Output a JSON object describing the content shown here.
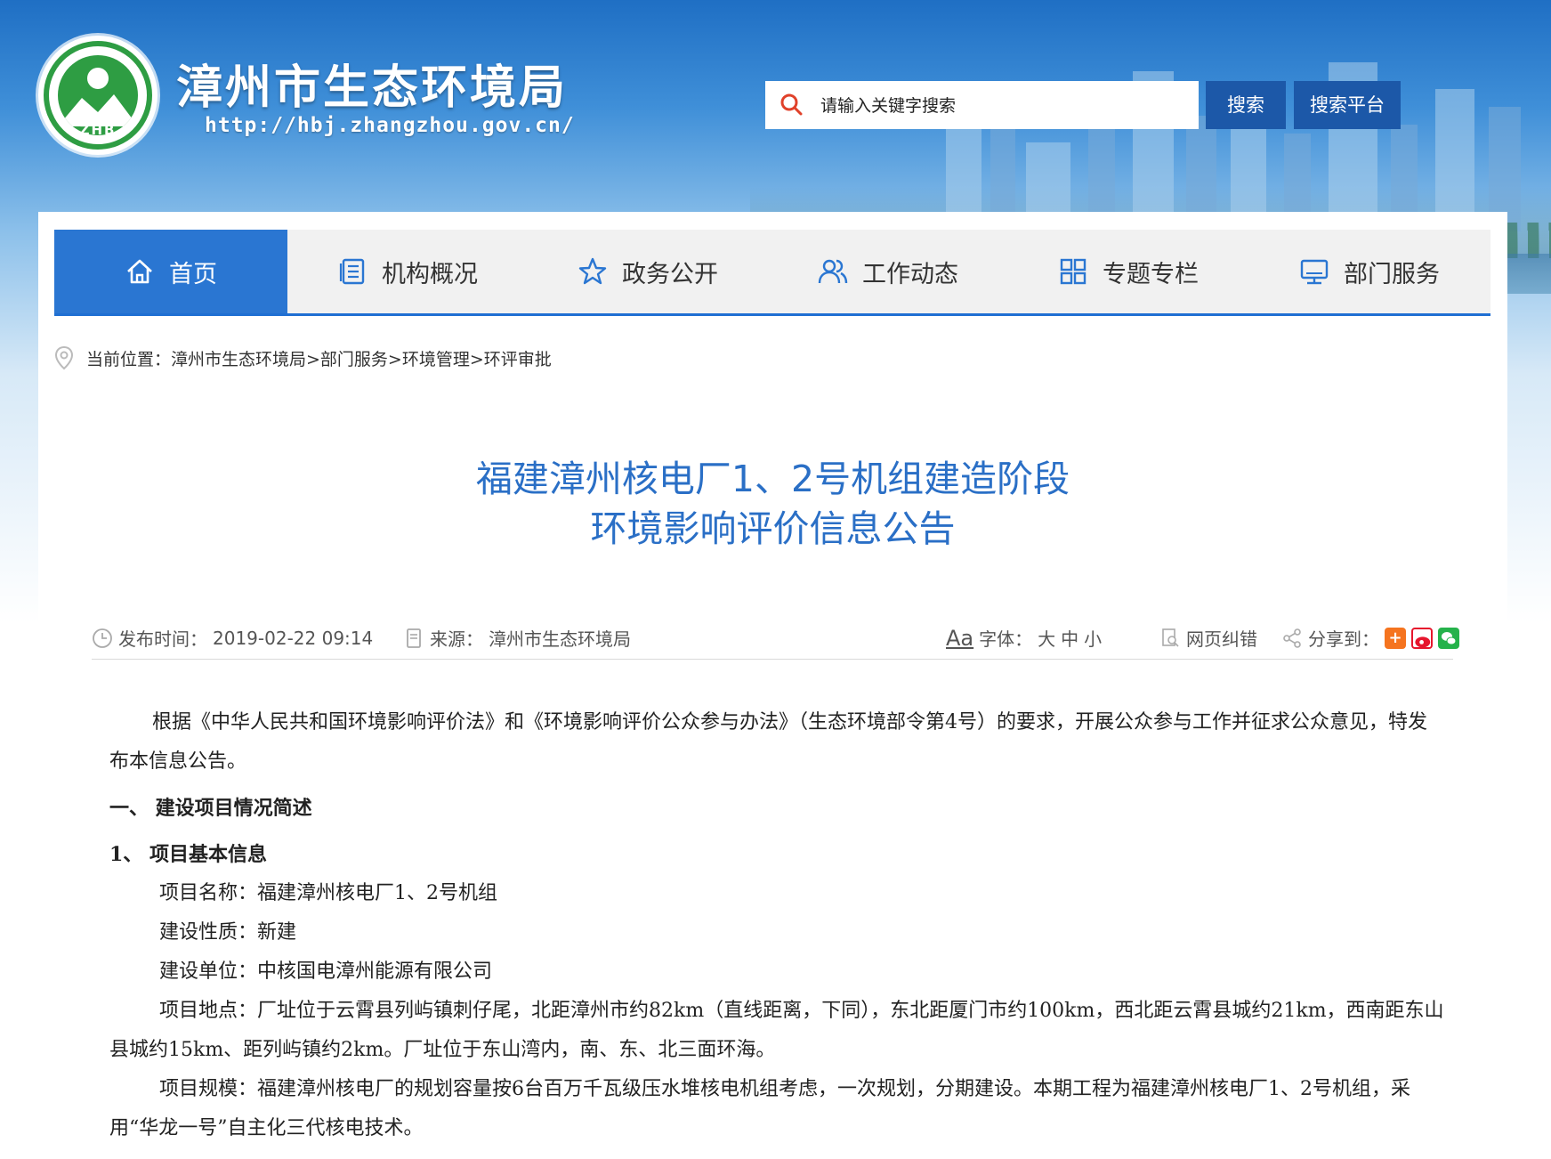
{
  "header": {
    "site_title": "漳州市生态环境局",
    "site_url": "http://hbj.zhangzhou.gov.cn/",
    "logo_text": "ZHB",
    "search_placeholder": "请输入关键字搜索",
    "search_button": "搜索",
    "search_platform_button": "搜索平台"
  },
  "nav": {
    "items": [
      {
        "label": "首页",
        "icon": "home-icon",
        "active": true
      },
      {
        "label": "机构概况",
        "icon": "document-list-icon"
      },
      {
        "label": "政务公开",
        "icon": "star-icon"
      },
      {
        "label": "工作动态",
        "icon": "users-icon"
      },
      {
        "label": "专题专栏",
        "icon": "grid-icon"
      },
      {
        "label": "部门服务",
        "icon": "monitor-icon"
      }
    ]
  },
  "breadcrumb": {
    "prefix": "当前位置：",
    "path": "漳州市生态环境局>部门服务>环境管理>环评审批"
  },
  "article": {
    "title_line1": "福建漳州核电厂1、2号机组建造阶段",
    "title_line2": "环境影响评价信息公告",
    "publish_label": "发布时间：",
    "publish_time": "2019-02-22 09:14",
    "source_label": "来源：",
    "source": "漳州市生态环境局",
    "font_icon_text": "Aa",
    "font_label": "字体：",
    "font_large": "大",
    "font_medium": "中",
    "font_small": "小",
    "error_report": "网页纠错",
    "share_label": "分享到：",
    "paragraphs": {
      "intro": "根据《中华人民共和国环境影响评价法》和《环境影响评价公众参与办法》（生态环境部令第4号）的要求，开展公众参与工作并征求公众意见，特发布本信息公告。",
      "section1": "一、 建设项目情况简述",
      "sub1": "1、  项目基本信息",
      "name": "项目名称：福建漳州核电厂1、2号机组",
      "nature": "建设性质：新建",
      "unit": "建设单位：中核国电漳州能源有限公司",
      "location": "项目地点：厂址位于云霄县列屿镇刺仔尾，北距漳州市约82km（直线距离，下同），东北距厦门市约100km，西北距云霄县城约21km，西南距东山县城约15km、距列屿镇约2km。厂址位于东山湾内，南、东、北三面环海。",
      "scale": "项目规模：福建漳州核电厂的规划容量按6台百万千瓦级压水堆核电机组考虑，一次规划，分期建设。本期工程为福建漳州核电厂1、2号机组，采用“华龙一号”自主化三代核电技术。"
    }
  },
  "colors": {
    "accent": "#2a76d2",
    "title_blue": "#2a6fc6",
    "button_blue": "#1c58a8",
    "search_icon": "#e0412a"
  }
}
